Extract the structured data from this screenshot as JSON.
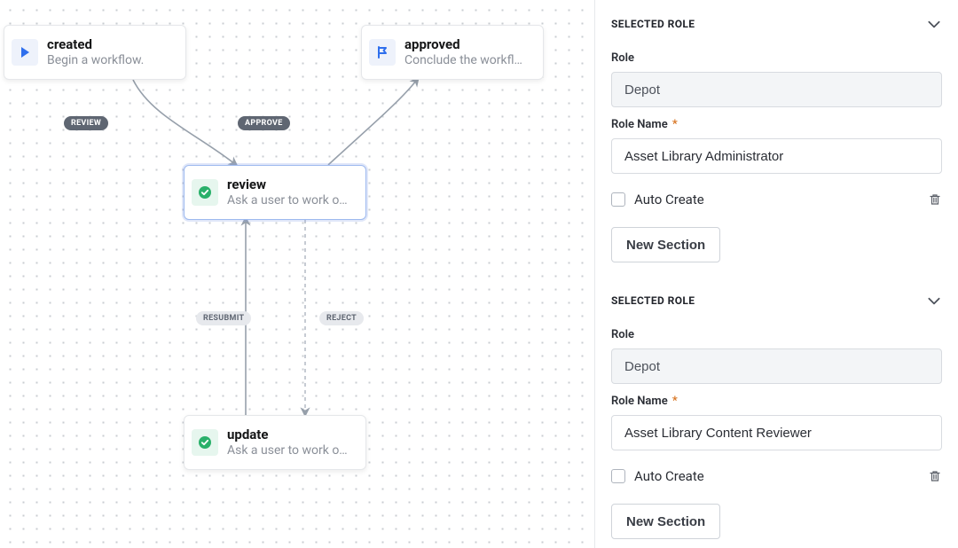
{
  "canvas": {
    "nodes": {
      "created": {
        "title": "created",
        "subtitle": "Begin a workflow."
      },
      "approved": {
        "title": "approved",
        "subtitle": "Conclude the workfl…"
      },
      "review": {
        "title": "review",
        "subtitle": "Ask a user to work o…"
      },
      "update": {
        "title": "update",
        "subtitle": "Ask a user to work o…"
      }
    },
    "edges": {
      "review": "REVIEW",
      "approve": "APPROVE",
      "resubmit": "RESUBMIT",
      "reject": "REJECT"
    }
  },
  "sidebar": {
    "sections": [
      {
        "header": "SELECTED ROLE",
        "role_label": "Role",
        "role_value": "Depot",
        "role_name_label": "Role Name",
        "role_name_required": "*",
        "role_name_value": "Asset Library Administrator",
        "auto_create_label": "Auto Create",
        "new_section_label": "New Section"
      },
      {
        "header": "SELECTED ROLE",
        "role_label": "Role",
        "role_value": "Depot",
        "role_name_label": "Role Name",
        "role_name_required": "*",
        "role_name_value": "Asset Library Content Reviewer",
        "auto_create_label": "Auto Create",
        "new_section_label": "New Section"
      }
    ]
  }
}
